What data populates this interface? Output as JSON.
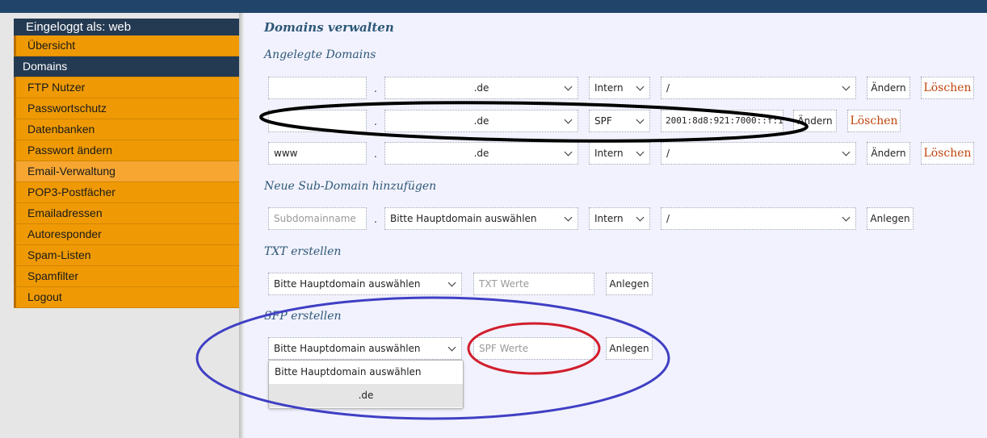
{
  "sidebar": {
    "logged_in": "Eingeloggt als: web",
    "items": [
      {
        "label": "Übersicht"
      },
      {
        "label": "Domains"
      },
      {
        "label": "FTP Nutzer"
      },
      {
        "label": "Passwortschutz"
      },
      {
        "label": "Datenbanken"
      },
      {
        "label": "Passwort ändern"
      },
      {
        "label": "Email-Verwaltung"
      },
      {
        "label": "POP3-Postfächer"
      },
      {
        "label": "Emailadressen"
      },
      {
        "label": "Autoresponder"
      },
      {
        "label": "Spam-Listen"
      },
      {
        "label": "Spamfilter"
      },
      {
        "label": "Logout"
      }
    ]
  },
  "main": {
    "title": "Domains verwalten",
    "sections": {
      "existing": "Angelegte Domains",
      "new_sub": "Neue Sub-Domain hinzufügen",
      "txt": "TXT erstellen",
      "spf": "SFP erstellen"
    },
    "separator": ".",
    "domains": [
      {
        "sub": "",
        "domain": ".de",
        "type": "Intern",
        "target": "/",
        "change": "Ändern",
        "delete": "Löschen"
      },
      {
        "sub": "",
        "domain": ".de",
        "type": "SPF",
        "target": "2001:8d8:921:7000::f:1",
        "change": "Ändern",
        "delete": "Löschen"
      },
      {
        "sub": "www",
        "domain": ".de",
        "type": "Intern",
        "target": "/",
        "change": "Ändern",
        "delete": "Löschen"
      }
    ],
    "new_sub": {
      "placeholder": "Subdomainname",
      "domain": "Bitte Hauptdomain auswählen",
      "type": "Intern",
      "target": "/",
      "button": "Anlegen"
    },
    "txt": {
      "domain": "Bitte Hauptdomain auswählen",
      "placeholder": "TXT Werte",
      "button": "Anlegen"
    },
    "spf": {
      "domain": "Bitte Hauptdomain auswählen",
      "placeholder": "SPF Werte",
      "button": "Anlegen",
      "options": [
        "Bitte Hauptdomain auswählen",
        ".de"
      ]
    }
  },
  "annotations": {
    "black": "#000000",
    "blue": "#3f3fc4",
    "red": "#d21d2b"
  }
}
